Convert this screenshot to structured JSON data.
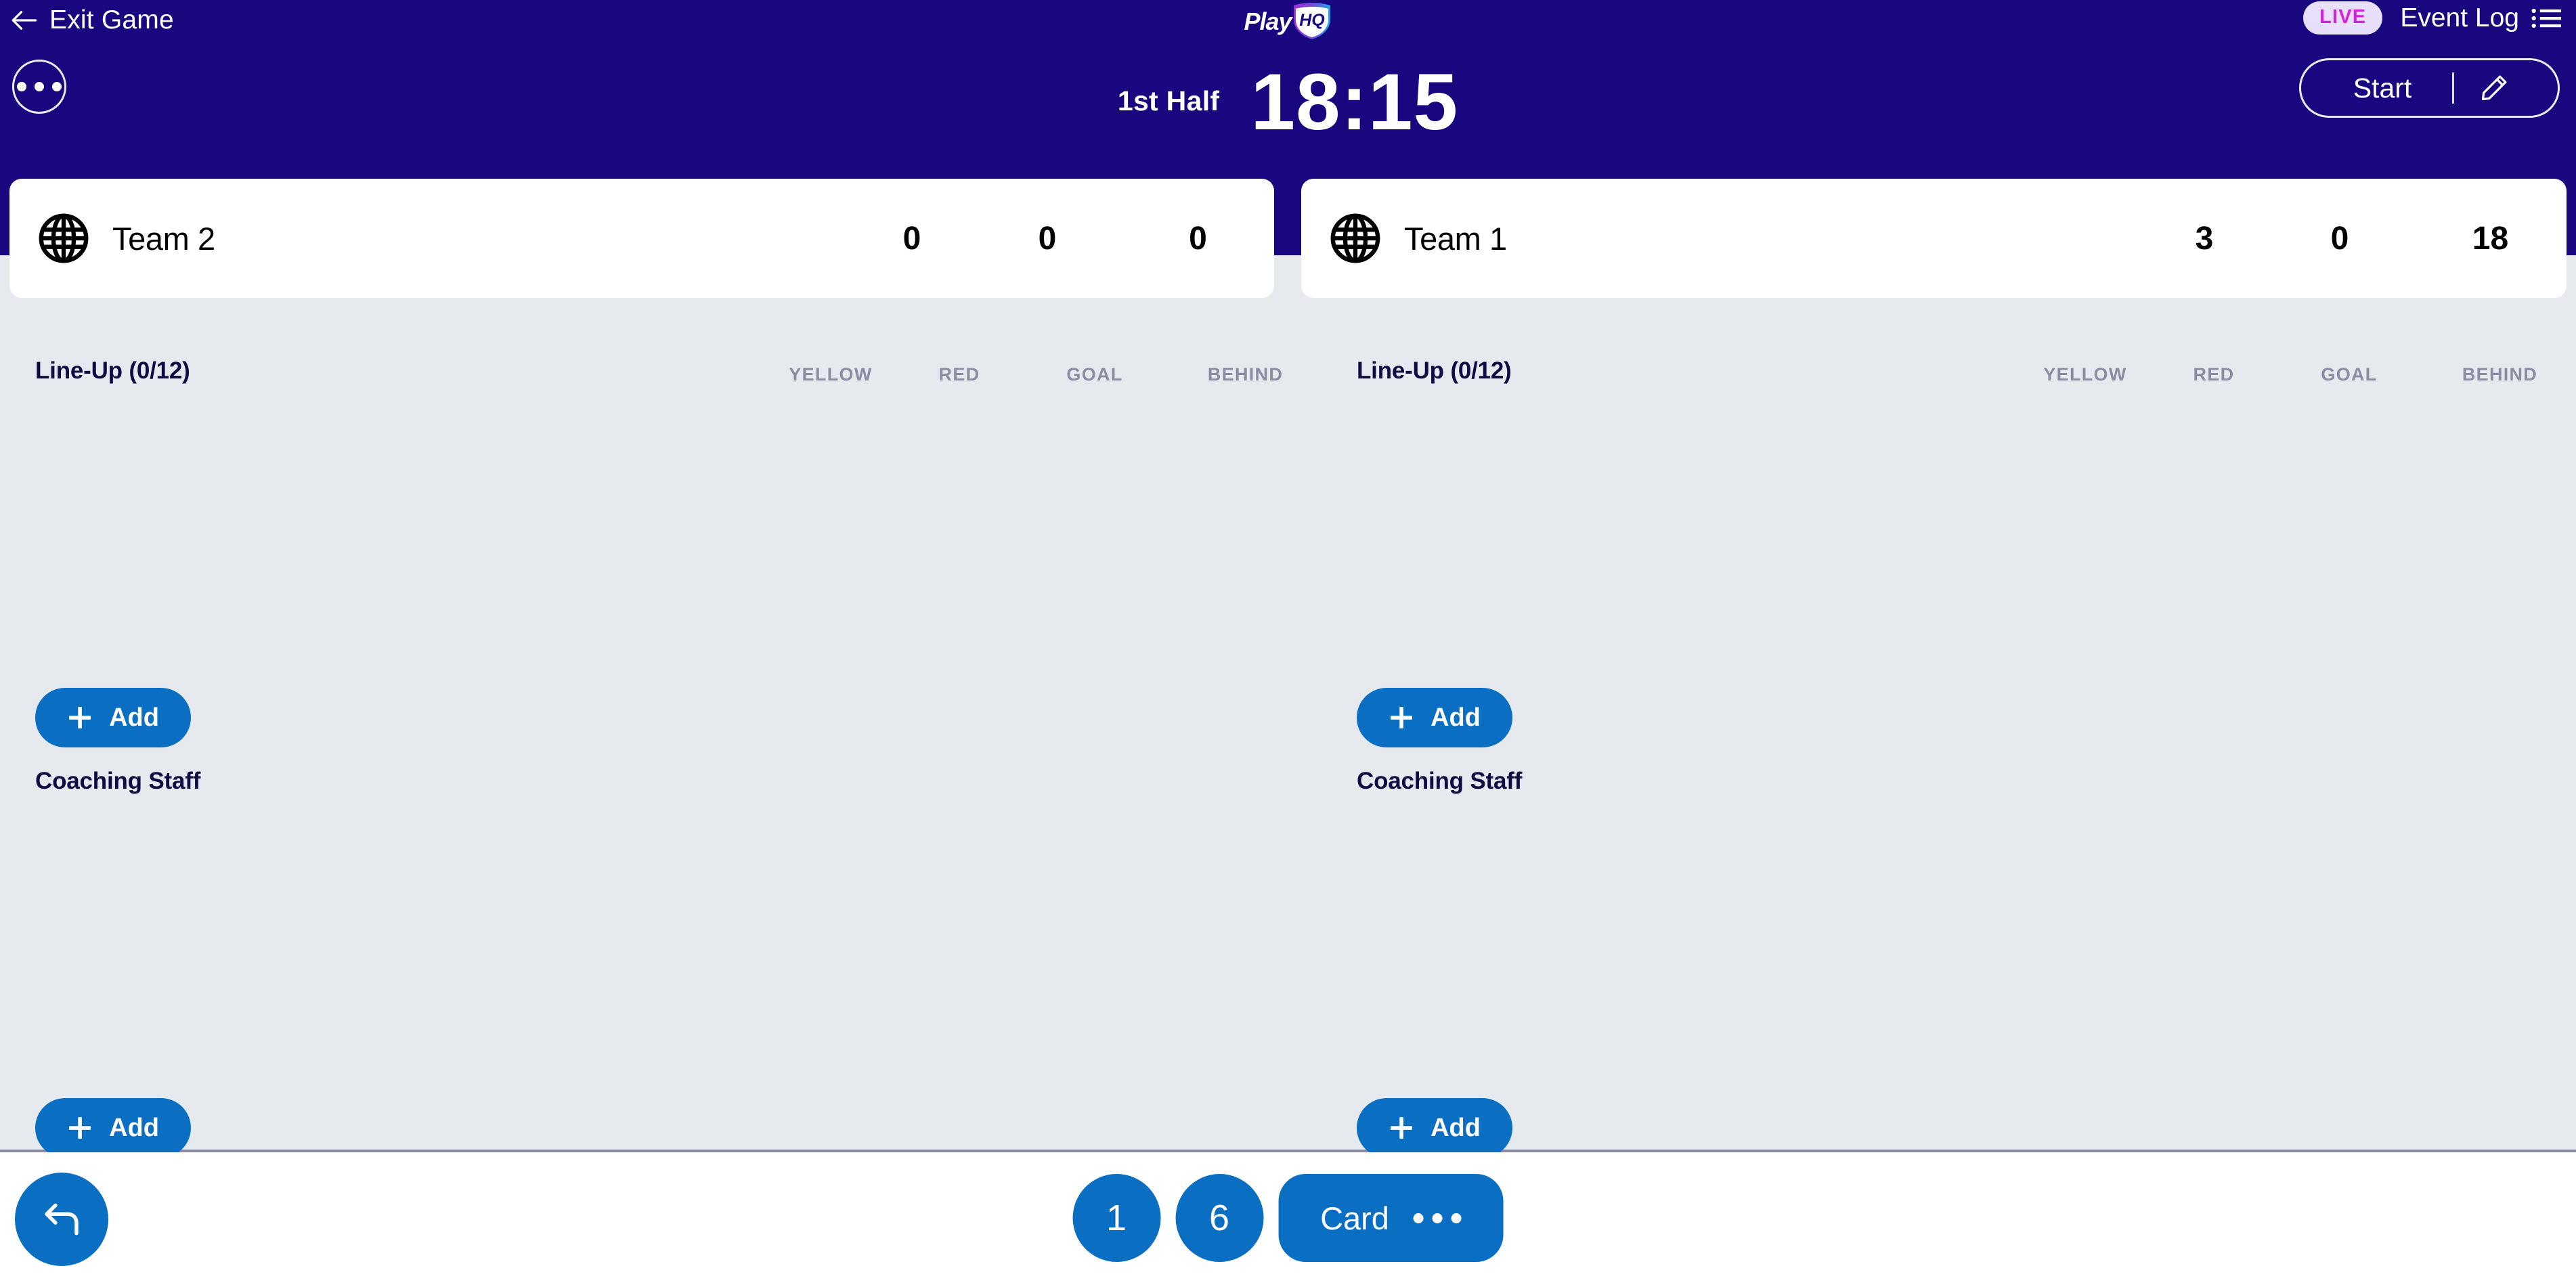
{
  "topnav": {
    "exit_label": "Exit Game",
    "back_icon": "arrow-left-icon",
    "logo_text": "Play",
    "logo_mark": "HQ",
    "live_badge": "LIVE",
    "event_log_label": "Event Log",
    "list_icon": "list-icon",
    "more_icon": "ellipsis-icon",
    "period_label": "1st Half",
    "clock": "18:15",
    "start_label": "Start",
    "edit_icon": "pencil-icon",
    "bg_color": "#18077E",
    "live_badge_bg": "#E8DFFA",
    "live_badge_text_color": "#D321E0"
  },
  "columns": [
    "YELLOW",
    "RED",
    "GOAL",
    "BEHIND"
  ],
  "teams": [
    {
      "name": "Team 2",
      "logo_icon": "globe-icon",
      "scores": [
        "0",
        "0",
        "0"
      ],
      "lineup_title": "Line-Up (0/12)",
      "lineup_add_label": "Add",
      "coaching_title": "Coaching Staff",
      "coaching_add_label": "Add"
    },
    {
      "name": "Team 1",
      "logo_icon": "globe-icon",
      "scores": [
        "3",
        "0",
        "18"
      ],
      "lineup_title": "Line-Up (0/12)",
      "lineup_add_label": "Add",
      "coaching_title": "Coaching Staff",
      "coaching_add_label": "Add"
    }
  ],
  "bottombar": {
    "undo_icon": "undo-arrow-icon",
    "score_buttons": [
      "1",
      "6"
    ],
    "card_label": "Card",
    "card_more_icon": "ellipsis-icon",
    "accent_color": "#0A6FC2"
  }
}
